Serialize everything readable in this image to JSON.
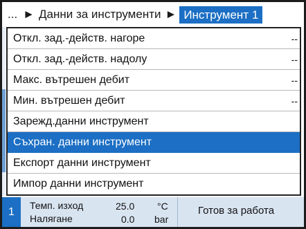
{
  "breadcrumb": {
    "ellipsis": "...",
    "separator": "►",
    "parent": "Данни за инструменти",
    "current": "Инструмент 1"
  },
  "menu": {
    "items": [
      {
        "label": "Откл. зад.-действ. нагоре",
        "value": "--"
      },
      {
        "label": "Откл. зад.-действ. надолу",
        "value": "--"
      },
      {
        "label": "Макс. вътрешен дебит",
        "value": "--"
      },
      {
        "label": "Мин. вътрешен дебит",
        "value": "--"
      },
      {
        "label": "Зарежд.данни инструмент",
        "value": ""
      },
      {
        "label": "Съхран. данни инструмент",
        "value": "",
        "selected": true
      },
      {
        "label": "Експорт данни инструмент",
        "value": ""
      },
      {
        "label": "Импор данни инструмент",
        "value": ""
      }
    ]
  },
  "status": {
    "number": "1",
    "temp_label": "Темп. изход",
    "temp_value": "25.0",
    "temp_unit": "°C",
    "pressure_label": "Налягане",
    "pressure_value": "0.0",
    "pressure_unit": "bar",
    "state": "Готов за работа"
  },
  "colors": {
    "accent": "#1c6fc4",
    "status_bg": "#d9e4f1",
    "frame": "#1b1b1b"
  }
}
